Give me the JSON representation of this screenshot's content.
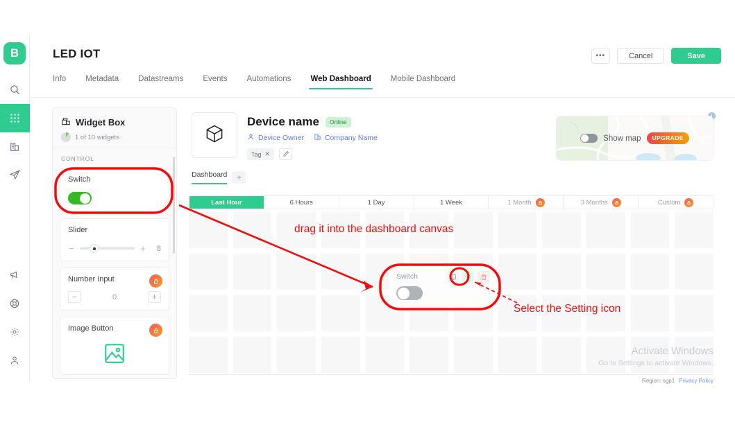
{
  "brand": {
    "logo_letter": "B",
    "accent": "#2ecc8f"
  },
  "rail": {
    "items": [
      {
        "name": "search-icon",
        "label": "Search",
        "active": false
      },
      {
        "name": "grid-apps-icon",
        "label": "Devices",
        "active": true
      },
      {
        "name": "building-icon",
        "label": "Organizations",
        "active": false
      },
      {
        "name": "paper-plane-icon",
        "label": "Messages",
        "active": false
      },
      {
        "name": "megaphone-icon",
        "label": "Announcements",
        "active": false
      },
      {
        "name": "lifebuoy-icon",
        "label": "Support",
        "active": false
      },
      {
        "name": "gear-icon",
        "label": "Settings",
        "active": false
      },
      {
        "name": "user-icon",
        "label": "Account",
        "active": false
      }
    ]
  },
  "header": {
    "title": "LED IOT",
    "more_label": "•••",
    "cancel_label": "Cancel",
    "save_label": "Save",
    "info_label": "i",
    "tabs": [
      {
        "label": "Info",
        "active": false
      },
      {
        "label": "Metadata",
        "active": false
      },
      {
        "label": "Datastreams",
        "active": false
      },
      {
        "label": "Events",
        "active": false
      },
      {
        "label": "Automations",
        "active": false
      },
      {
        "label": "Web Dashboard",
        "active": true
      },
      {
        "label": "Mobile Dashboard",
        "active": false
      }
    ]
  },
  "widget_box": {
    "title": "Widget Box",
    "subtitle": "1 of 10 widgets",
    "category": "CONTROL",
    "widgets": [
      {
        "title": "Switch",
        "type": "switch",
        "toggle_state": "on",
        "locked": false
      },
      {
        "title": "Slider",
        "type": "slider",
        "value": "8",
        "minus": "−",
        "plus": "+",
        "locked": false
      },
      {
        "title": "Number Input",
        "type": "number",
        "value": "0",
        "minus": "−",
        "plus": "+",
        "locked": true
      },
      {
        "title": "Image Button",
        "type": "image",
        "locked": true
      }
    ]
  },
  "device": {
    "name": "Device name",
    "status_badge": "Online",
    "owner_label": "Device Owner",
    "company_label": "Company Name",
    "tag_label": "Tag",
    "tag_remove": "✕",
    "thumb_icon": "cube-icon"
  },
  "map": {
    "toggle_state": "off",
    "label": "Show map",
    "upgrade_label": "UPGRADE"
  },
  "dashboard": {
    "tab_label": "Dashboard",
    "add_label": "+",
    "ranges": [
      {
        "label": "Last Hour",
        "active": true,
        "locked": false
      },
      {
        "label": "6 Hours",
        "active": false,
        "locked": false
      },
      {
        "label": "1 Day",
        "active": false,
        "locked": false
      },
      {
        "label": "1 Week",
        "active": false,
        "locked": false
      },
      {
        "label": "1 Month",
        "active": false,
        "locked": true
      },
      {
        "label": "3 Months",
        "active": false,
        "locked": true
      },
      {
        "label": "Custom",
        "active": false,
        "locked": true
      }
    ],
    "grid_columns": 12,
    "grid_rows": 4
  },
  "dropped_widget": {
    "title": "Switch",
    "toggle_state": "off",
    "actions": [
      {
        "name": "copy-icon",
        "label": "Duplicate"
      },
      {
        "name": "gear-icon",
        "label": "Settings"
      },
      {
        "name": "trash-icon",
        "label": "Delete"
      }
    ]
  },
  "annotations": {
    "color": "#f40c0c",
    "drag_text": "drag it into the dashboard canvas",
    "select_text": "Select the Setting icon"
  },
  "watermark": {
    "line1": "Activate Windows",
    "line2": "Go to Settings to activate Windows."
  },
  "footer": {
    "region": "Region: sgp1",
    "privacy": "Privacy Policy"
  }
}
